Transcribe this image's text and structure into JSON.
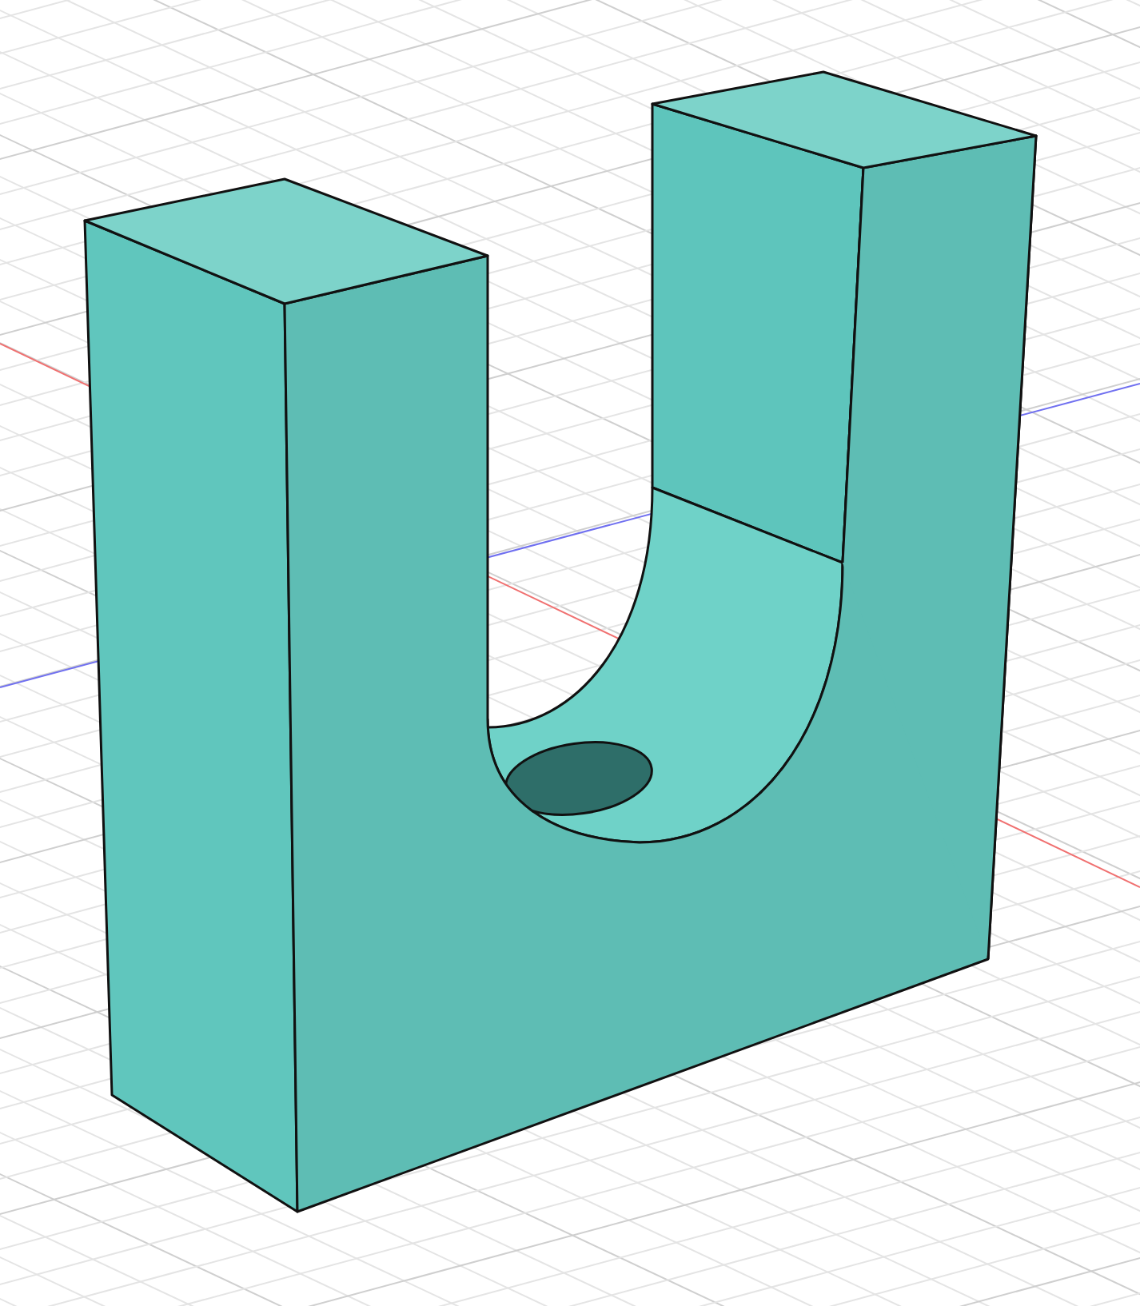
{
  "viewport": {
    "show_grid": true,
    "show_axes": true,
    "model": {
      "kind": "u-block",
      "has_hole": true
    }
  }
}
